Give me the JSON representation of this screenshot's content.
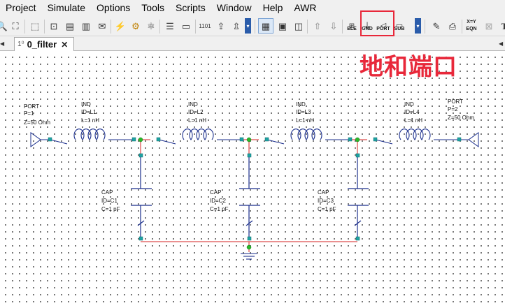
{
  "menu": [
    "Project",
    "Simulate",
    "Options",
    "Tools",
    "Scripts",
    "Window",
    "Help",
    "AWR"
  ],
  "toolbar": {
    "labels": {
      "ele": "ELE",
      "gnd": "GND",
      "port": "PORT",
      "sub": "SUB",
      "eqn_top": "X=Y",
      "eqn": "EQN"
    }
  },
  "tab": {
    "label": "0_filter",
    "close": "✕",
    "icon": "1⁰"
  },
  "annotation": "地和端口",
  "schematic": {
    "ports": [
      {
        "name": "PORT",
        "p": "P=1",
        "z": "Z=50 Ohm"
      },
      {
        "name": "PORT",
        "p": "P=2",
        "z": "Z=50 Ohm"
      }
    ],
    "inductors": [
      {
        "name": "IND",
        "id": "ID=L1",
        "value": "L=1 nH"
      },
      {
        "name": "IND",
        "id": "ID=L2",
        "value": "L=1 nH"
      },
      {
        "name": "IND",
        "id": "ID=L3",
        "value": "L=1 nH"
      },
      {
        "name": "IND",
        "id": "ID=L4",
        "value": "L=1 nH"
      }
    ],
    "capacitors": [
      {
        "name": "CAP",
        "id": "ID=C1",
        "value": "C=1 pF"
      },
      {
        "name": "CAP",
        "id": "ID=C2",
        "value": "C=1 pF"
      },
      {
        "name": "CAP",
        "id": "ID=C3",
        "value": "C=1 pF"
      }
    ]
  },
  "colors": {
    "wire": "#d42020",
    "node": "#2ab82a",
    "pin": "#1fa3a3",
    "component": "#1b2f8c",
    "annotation": "#e8283a"
  }
}
